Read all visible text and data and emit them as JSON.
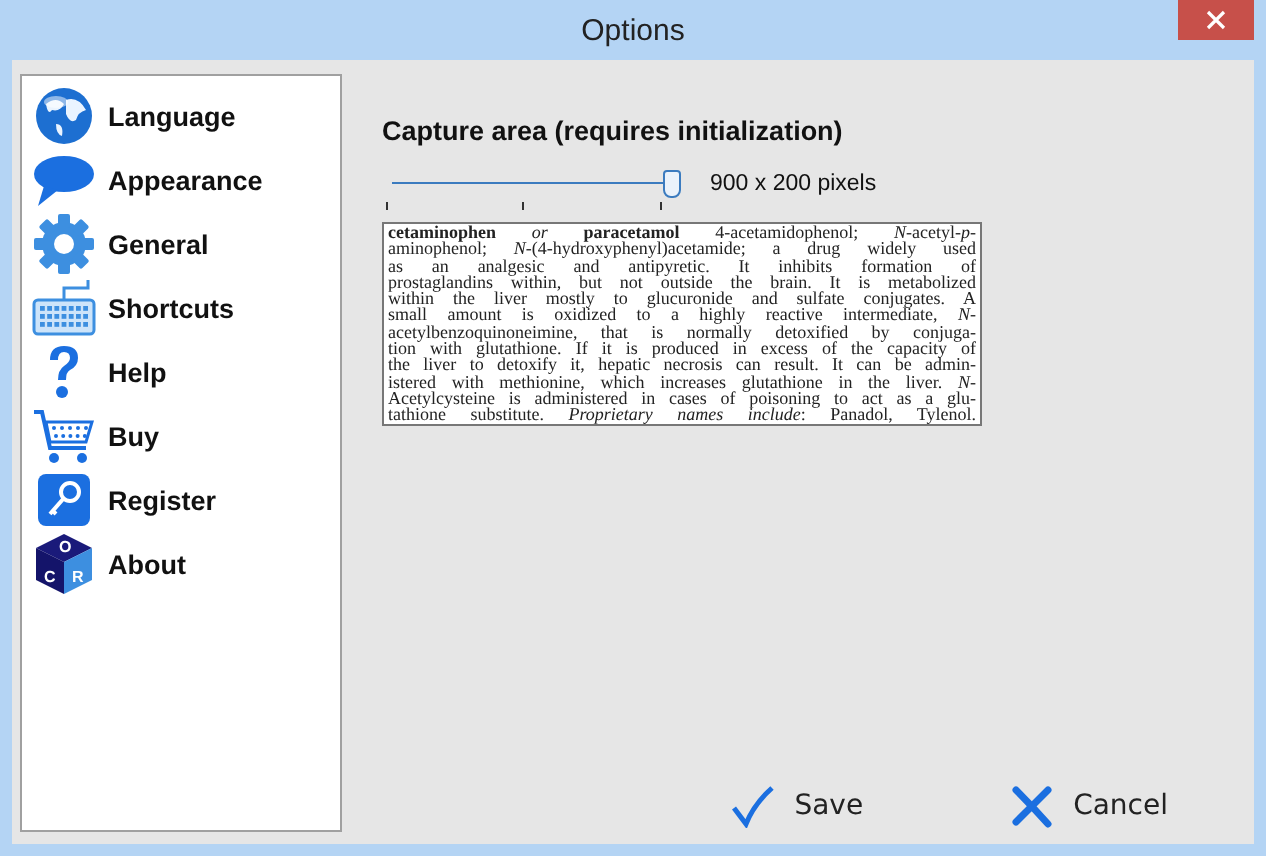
{
  "window": {
    "title": "Options"
  },
  "sidebar": {
    "items": [
      {
        "label": "Language",
        "kind": "globe"
      },
      {
        "label": "Appearance",
        "kind": "bubble"
      },
      {
        "label": "General",
        "kind": "gear"
      },
      {
        "label": "Shortcuts",
        "kind": "keyboard"
      },
      {
        "label": "Help",
        "kind": "question"
      },
      {
        "label": "Buy",
        "kind": "cart"
      },
      {
        "label": "Register",
        "kind": "key"
      },
      {
        "label": "About",
        "kind": "cube",
        "icon_letters": [
          "O",
          "C",
          "R"
        ]
      }
    ]
  },
  "capture": {
    "heading": "Capture area (requires initialization)",
    "slider": {
      "level": 1.0,
      "reading": "900 x 200 pixels"
    },
    "preview_lines": [
      "**cetaminophen** *or* **paracetamol** 4-acetamidophenol; *N*-acetyl-*p*-",
      "aminophenol; *N*-(4-hydroxyphenyl)acetamide; a drug widely used",
      "as an analgesic and antipyretic. It inhibits formation of",
      "prostaglandins within, but not outside the brain. It is metabolized",
      "within the liver mostly to glucuronide and sulfate conjugates. A",
      "small amount is oxidized to a highly reactive intermediate, *N*-",
      "acetylbenzoquinoneimine, that is normally detoxified by conjuga-",
      "tion with glutathione. If it is produced in excess of the capacity of",
      "the liver to detoxify it, hepatic necrosis can result. It can be admin-",
      "istered with methionine, which increases glutathione in the liver. *N*-",
      "Acetylcysteine is administered in cases of poisoning to act as a glu-",
      "tathione substitute. *Proprietary names include*: Panadol, Tylenol."
    ]
  },
  "buttons": [
    {
      "label": "Save",
      "kind": "save"
    },
    {
      "label": "Cancel",
      "kind": "cancel"
    }
  ]
}
